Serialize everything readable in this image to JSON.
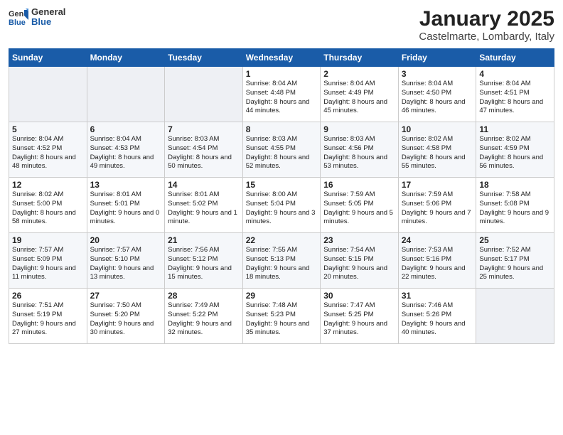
{
  "logo": {
    "general": "General",
    "blue": "Blue"
  },
  "title": "January 2025",
  "location": "Castelmarte, Lombardy, Italy",
  "weekdays": [
    "Sunday",
    "Monday",
    "Tuesday",
    "Wednesday",
    "Thursday",
    "Friday",
    "Saturday"
  ],
  "weeks": [
    [
      {
        "day": "",
        "sunrise": "",
        "sunset": "",
        "daylight": ""
      },
      {
        "day": "",
        "sunrise": "",
        "sunset": "",
        "daylight": ""
      },
      {
        "day": "",
        "sunrise": "",
        "sunset": "",
        "daylight": ""
      },
      {
        "day": "1",
        "sunrise": "Sunrise: 8:04 AM",
        "sunset": "Sunset: 4:48 PM",
        "daylight": "Daylight: 8 hours and 44 minutes."
      },
      {
        "day": "2",
        "sunrise": "Sunrise: 8:04 AM",
        "sunset": "Sunset: 4:49 PM",
        "daylight": "Daylight: 8 hours and 45 minutes."
      },
      {
        "day": "3",
        "sunrise": "Sunrise: 8:04 AM",
        "sunset": "Sunset: 4:50 PM",
        "daylight": "Daylight: 8 hours and 46 minutes."
      },
      {
        "day": "4",
        "sunrise": "Sunrise: 8:04 AM",
        "sunset": "Sunset: 4:51 PM",
        "daylight": "Daylight: 8 hours and 47 minutes."
      }
    ],
    [
      {
        "day": "5",
        "sunrise": "Sunrise: 8:04 AM",
        "sunset": "Sunset: 4:52 PM",
        "daylight": "Daylight: 8 hours and 48 minutes."
      },
      {
        "day": "6",
        "sunrise": "Sunrise: 8:04 AM",
        "sunset": "Sunset: 4:53 PM",
        "daylight": "Daylight: 8 hours and 49 minutes."
      },
      {
        "day": "7",
        "sunrise": "Sunrise: 8:03 AM",
        "sunset": "Sunset: 4:54 PM",
        "daylight": "Daylight: 8 hours and 50 minutes."
      },
      {
        "day": "8",
        "sunrise": "Sunrise: 8:03 AM",
        "sunset": "Sunset: 4:55 PM",
        "daylight": "Daylight: 8 hours and 52 minutes."
      },
      {
        "day": "9",
        "sunrise": "Sunrise: 8:03 AM",
        "sunset": "Sunset: 4:56 PM",
        "daylight": "Daylight: 8 hours and 53 minutes."
      },
      {
        "day": "10",
        "sunrise": "Sunrise: 8:02 AM",
        "sunset": "Sunset: 4:58 PM",
        "daylight": "Daylight: 8 hours and 55 minutes."
      },
      {
        "day": "11",
        "sunrise": "Sunrise: 8:02 AM",
        "sunset": "Sunset: 4:59 PM",
        "daylight": "Daylight: 8 hours and 56 minutes."
      }
    ],
    [
      {
        "day": "12",
        "sunrise": "Sunrise: 8:02 AM",
        "sunset": "Sunset: 5:00 PM",
        "daylight": "Daylight: 8 hours and 58 minutes."
      },
      {
        "day": "13",
        "sunrise": "Sunrise: 8:01 AM",
        "sunset": "Sunset: 5:01 PM",
        "daylight": "Daylight: 9 hours and 0 minutes."
      },
      {
        "day": "14",
        "sunrise": "Sunrise: 8:01 AM",
        "sunset": "Sunset: 5:02 PM",
        "daylight": "Daylight: 9 hours and 1 minute."
      },
      {
        "day": "15",
        "sunrise": "Sunrise: 8:00 AM",
        "sunset": "Sunset: 5:04 PM",
        "daylight": "Daylight: 9 hours and 3 minutes."
      },
      {
        "day": "16",
        "sunrise": "Sunrise: 7:59 AM",
        "sunset": "Sunset: 5:05 PM",
        "daylight": "Daylight: 9 hours and 5 minutes."
      },
      {
        "day": "17",
        "sunrise": "Sunrise: 7:59 AM",
        "sunset": "Sunset: 5:06 PM",
        "daylight": "Daylight: 9 hours and 7 minutes."
      },
      {
        "day": "18",
        "sunrise": "Sunrise: 7:58 AM",
        "sunset": "Sunset: 5:08 PM",
        "daylight": "Daylight: 9 hours and 9 minutes."
      }
    ],
    [
      {
        "day": "19",
        "sunrise": "Sunrise: 7:57 AM",
        "sunset": "Sunset: 5:09 PM",
        "daylight": "Daylight: 9 hours and 11 minutes."
      },
      {
        "day": "20",
        "sunrise": "Sunrise: 7:57 AM",
        "sunset": "Sunset: 5:10 PM",
        "daylight": "Daylight: 9 hours and 13 minutes."
      },
      {
        "day": "21",
        "sunrise": "Sunrise: 7:56 AM",
        "sunset": "Sunset: 5:12 PM",
        "daylight": "Daylight: 9 hours and 15 minutes."
      },
      {
        "day": "22",
        "sunrise": "Sunrise: 7:55 AM",
        "sunset": "Sunset: 5:13 PM",
        "daylight": "Daylight: 9 hours and 18 minutes."
      },
      {
        "day": "23",
        "sunrise": "Sunrise: 7:54 AM",
        "sunset": "Sunset: 5:15 PM",
        "daylight": "Daylight: 9 hours and 20 minutes."
      },
      {
        "day": "24",
        "sunrise": "Sunrise: 7:53 AM",
        "sunset": "Sunset: 5:16 PM",
        "daylight": "Daylight: 9 hours and 22 minutes."
      },
      {
        "day": "25",
        "sunrise": "Sunrise: 7:52 AM",
        "sunset": "Sunset: 5:17 PM",
        "daylight": "Daylight: 9 hours and 25 minutes."
      }
    ],
    [
      {
        "day": "26",
        "sunrise": "Sunrise: 7:51 AM",
        "sunset": "Sunset: 5:19 PM",
        "daylight": "Daylight: 9 hours and 27 minutes."
      },
      {
        "day": "27",
        "sunrise": "Sunrise: 7:50 AM",
        "sunset": "Sunset: 5:20 PM",
        "daylight": "Daylight: 9 hours and 30 minutes."
      },
      {
        "day": "28",
        "sunrise": "Sunrise: 7:49 AM",
        "sunset": "Sunset: 5:22 PM",
        "daylight": "Daylight: 9 hours and 32 minutes."
      },
      {
        "day": "29",
        "sunrise": "Sunrise: 7:48 AM",
        "sunset": "Sunset: 5:23 PM",
        "daylight": "Daylight: 9 hours and 35 minutes."
      },
      {
        "day": "30",
        "sunrise": "Sunrise: 7:47 AM",
        "sunset": "Sunset: 5:25 PM",
        "daylight": "Daylight: 9 hours and 37 minutes."
      },
      {
        "day": "31",
        "sunrise": "Sunrise: 7:46 AM",
        "sunset": "Sunset: 5:26 PM",
        "daylight": "Daylight: 9 hours and 40 minutes."
      },
      {
        "day": "",
        "sunrise": "",
        "sunset": "",
        "daylight": ""
      }
    ]
  ]
}
